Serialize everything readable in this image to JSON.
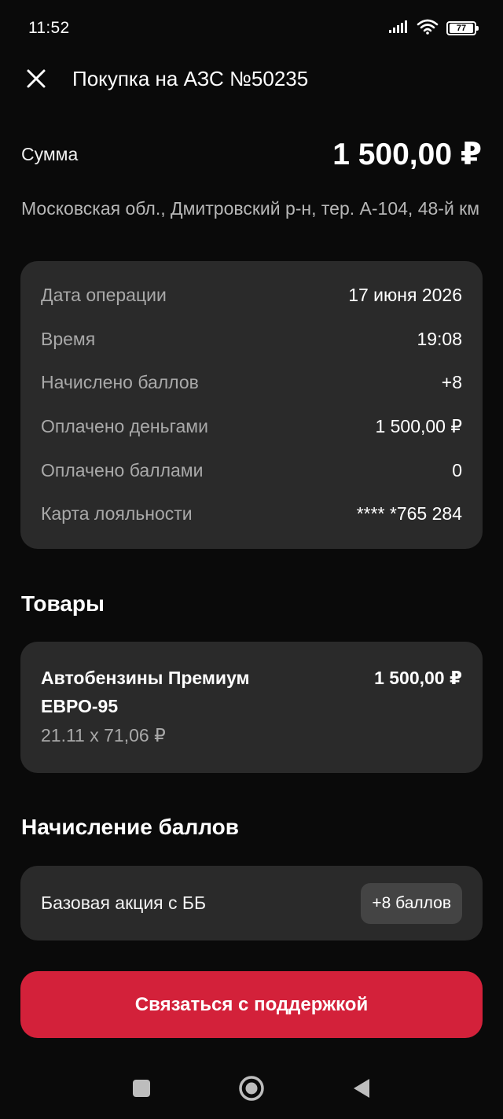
{
  "status_bar": {
    "time": "11:52",
    "battery": "77",
    "icons": [
      "signal-icon",
      "wifi-icon",
      "battery-icon"
    ]
  },
  "header": {
    "close_icon": "close-icon",
    "title": "Покупка на АЗС №50235"
  },
  "summary": {
    "sum_label": "Сумма",
    "sum_value": "1 500,00 ₽",
    "address": "Московская обл., Дмитровский р-н, тер. А-104, 48-й км"
  },
  "details": [
    {
      "label": "Дата операции",
      "value": "17 июня 2026"
    },
    {
      "label": "Время",
      "value": "19:08"
    },
    {
      "label": "Начислено баллов",
      "value": "+8"
    },
    {
      "label": "Оплачено деньгами",
      "value": "1 500,00 ₽"
    },
    {
      "label": "Оплачено баллами",
      "value": "0"
    },
    {
      "label": "Карта лояльности",
      "value": "**** *765 284"
    }
  ],
  "goods": {
    "title": "Товары",
    "items": [
      {
        "name": "Автобензины Премиум ЕВРО-95",
        "price": "1 500,00 ₽",
        "qty": "21.11 x 71,06 ₽"
      }
    ]
  },
  "bonuses": {
    "title": "Начисление баллов",
    "items": [
      {
        "label": "Базовая акция с ББ",
        "badge": "+8 баллов"
      }
    ]
  },
  "support_button": "Связаться с поддержкой",
  "nav_bar": {
    "icons": [
      "recents-icon",
      "home-icon",
      "back-icon"
    ]
  },
  "colors": {
    "background": "#0a0a0a",
    "card": "#2a2a2a",
    "accent": "#d3213a",
    "muted_text": "#a9a9a9"
  }
}
